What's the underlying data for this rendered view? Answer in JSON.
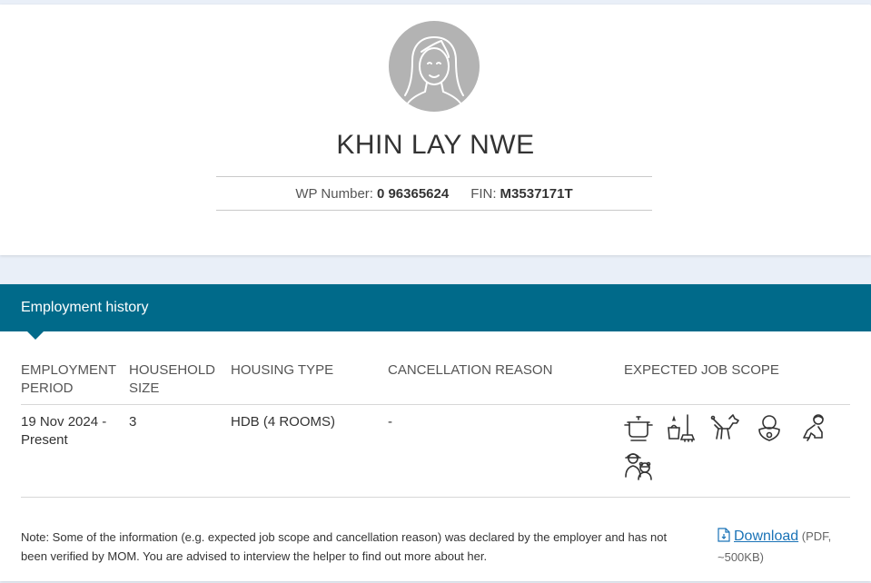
{
  "profile": {
    "name": "KHIN LAY NWE",
    "wp_label": "WP Number:",
    "wp_value": "0 96365624",
    "fin_label": "FIN:",
    "fin_value": "M3537171T",
    "avatar_icon": "female-avatar-icon"
  },
  "history": {
    "title": "Employment history",
    "columns": {
      "period": "EMPLOYMENT PERIOD",
      "household": "HOUSEHOLD SIZE",
      "housing": "HOUSING TYPE",
      "cancellation": "CANCELLATION REASON",
      "scope": "EXPECTED JOB SCOPE"
    },
    "rows": [
      {
        "period": "19 Nov 2024 - Present",
        "household": "3",
        "housing": "HDB (4 ROOMS)",
        "cancellation": "-",
        "scope_icons": [
          "cooking-pot-icon",
          "cleaning-icon",
          "pet-care-icon",
          "infant-care-icon",
          "child-care-icon",
          "elderly-care-icon"
        ]
      }
    ]
  },
  "footer": {
    "note": "Note: Some of the information (e.g. expected job scope and cancellation reason) was declared by the employer and has not been verified by MOM. You are advised to interview the helper to find out more about her.",
    "download_label": "Download",
    "download_meta": "(PDF, ~500KB)",
    "link_color": "#1a73b7"
  },
  "colors": {
    "header_bg": "#006a8a",
    "page_bg": "#e9eff8",
    "avatar_bg": "#b3b3b3"
  }
}
